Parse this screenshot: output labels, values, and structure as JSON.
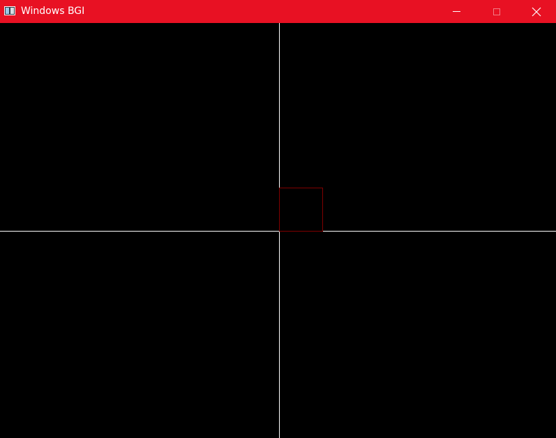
{
  "window": {
    "title": "Windows BGI",
    "titlebar_color": "#E81123",
    "canvas_background": "#000000"
  },
  "titlebar": {
    "icon": "bgi-app-icon",
    "buttons": [
      {
        "name": "minimize-button",
        "icon": "minimize-icon"
      },
      {
        "name": "maximize-button",
        "icon": "maximize-icon",
        "enabled": false
      },
      {
        "name": "close-button",
        "icon": "close-icon"
      }
    ]
  },
  "drawing": {
    "axis_color": "#FFFFFF",
    "square_color": "#800000"
  }
}
